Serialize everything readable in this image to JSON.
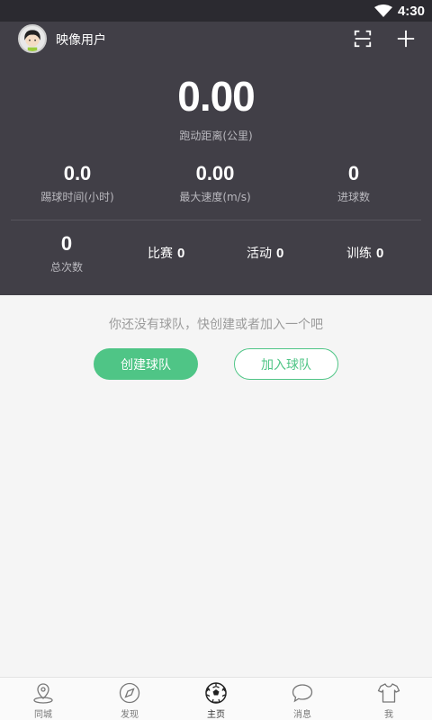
{
  "status": {
    "time": "4:30"
  },
  "header": {
    "username": "映像用户"
  },
  "stats": {
    "distance": {
      "value": "0.00",
      "label": "跑动距离(公里)"
    },
    "play_time": {
      "value": "0.0",
      "label": "踢球时间(小时)"
    },
    "max_speed": {
      "value": "0.00",
      "label": "最大速度(m/s)"
    },
    "goals": {
      "value": "0",
      "label": "进球数"
    },
    "total": {
      "value": "0",
      "label": "总次数"
    },
    "match": {
      "label": "比赛",
      "value": "0"
    },
    "activity": {
      "label": "活动",
      "value": "0"
    },
    "training": {
      "label": "训练",
      "value": "0"
    }
  },
  "team": {
    "empty_text": "你还没有球队，快创建或者加入一个吧",
    "create_label": "创建球队",
    "join_label": "加入球队"
  },
  "tabs": [
    {
      "label": "同城",
      "icon": "location-icon"
    },
    {
      "label": "发现",
      "icon": "compass-icon"
    },
    {
      "label": "主页",
      "icon": "soccer-ball-icon"
    },
    {
      "label": "消息",
      "icon": "chat-bubble-icon"
    },
    {
      "label": "我",
      "icon": "shirt-icon"
    }
  ],
  "colors": {
    "accent": "#4fc586",
    "hero_bg": "#413f47",
    "statusbar_bg": "#2b2a30"
  }
}
